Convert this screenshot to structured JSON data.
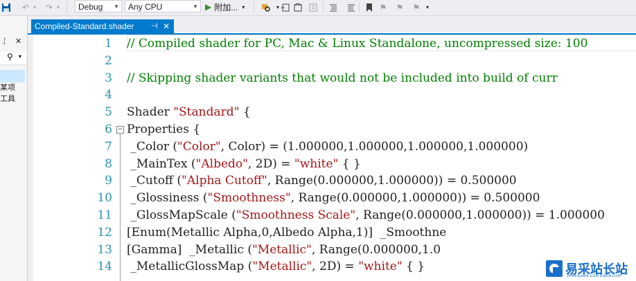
{
  "toolbar": {
    "configuration": "Debug",
    "platform": "Any CPU",
    "run_label": "附加...",
    "icons": [
      "save-icon",
      "undo-icon",
      "redo-icon",
      "start-icon",
      "find-icon",
      "comment-icon",
      "uncomment-icon",
      "bookmark-icon"
    ]
  },
  "left_pane": {
    "pin": "ᛇ",
    "label_a": "某项",
    "label_b": "工具"
  },
  "tab": {
    "title": "Compiled-Standard.shader",
    "pin": "⊣",
    "close": "✕"
  },
  "editor": {
    "lines": [
      {
        "n": "1",
        "segs": [
          {
            "t": "// Compiled shader for PC, Mac & Linux Standalone, uncompressed size: 100",
            "c": "comment"
          }
        ]
      },
      {
        "n": "2",
        "segs": []
      },
      {
        "n": "3",
        "segs": [
          {
            "t": "// Skipping shader variants that would not be included into build of curr",
            "c": "comment"
          }
        ]
      },
      {
        "n": "4",
        "segs": []
      },
      {
        "n": "5",
        "segs": [
          {
            "t": "Shader ",
            "c": ""
          },
          {
            "t": "\"Standard\"",
            "c": "str"
          },
          {
            "t": " {",
            "c": ""
          }
        ]
      },
      {
        "n": "6",
        "segs": [
          {
            "t": "Properties {",
            "c": ""
          }
        ]
      },
      {
        "n": "7",
        "segs": [
          {
            "t": " _Color (",
            "c": ""
          },
          {
            "t": "\"Color\"",
            "c": "str"
          },
          {
            "t": ", Color) = (1.000000,1.000000,1.000000,1.000000)",
            "c": ""
          }
        ]
      },
      {
        "n": "8",
        "segs": [
          {
            "t": " _MainTex (",
            "c": ""
          },
          {
            "t": "\"Albedo\"",
            "c": "str"
          },
          {
            "t": ", 2D) = ",
            "c": ""
          },
          {
            "t": "\"white\"",
            "c": "str"
          },
          {
            "t": " { }",
            "c": ""
          }
        ]
      },
      {
        "n": "9",
        "segs": [
          {
            "t": " _Cutoff (",
            "c": ""
          },
          {
            "t": "\"Alpha Cutoff\"",
            "c": "str"
          },
          {
            "t": ", Range(0.000000,1.000000)) = 0.500000",
            "c": ""
          }
        ]
      },
      {
        "n": "10",
        "segs": [
          {
            "t": " _Glossiness (",
            "c": ""
          },
          {
            "t": "\"Smoothness\"",
            "c": "str"
          },
          {
            "t": ", Range(0.000000,1.000000)) = 0.500000",
            "c": ""
          }
        ]
      },
      {
        "n": "11",
        "segs": [
          {
            "t": " _GlossMapScale (",
            "c": ""
          },
          {
            "t": "\"Smoothness Scale\"",
            "c": "str"
          },
          {
            "t": ", Range(0.000000,1.000000)) = 1.000000",
            "c": ""
          }
        ]
      },
      {
        "n": "12",
        "segs": [
          {
            "t": "[Enum(Metallic Alpha,0,Albedo Alpha,1)]  _Smoothne",
            "c": ""
          }
        ]
      },
      {
        "n": "13",
        "segs": [
          {
            "t": "[Gamma]  _Metallic (",
            "c": ""
          },
          {
            "t": "\"Metallic\"",
            "c": "str"
          },
          {
            "t": ", Range(0.000000,1.0",
            "c": ""
          }
        ]
      },
      {
        "n": "14",
        "segs": [
          {
            "t": " _MetallicGlossMap (",
            "c": ""
          },
          {
            "t": "\"Metallic\"",
            "c": "str"
          },
          {
            "t": ", 2D) = ",
            "c": ""
          },
          {
            "t": "\"white\"",
            "c": "str"
          },
          {
            "t": " { }",
            "c": ""
          }
        ]
      }
    ]
  },
  "watermark": {
    "name": "易采站长站",
    "sub": "Www.Easck.Com  Easck.Com"
  },
  "colors": {
    "accent": "#007acc",
    "comment": "#008000",
    "string": "#a31515",
    "line_number": "#2b91af"
  }
}
